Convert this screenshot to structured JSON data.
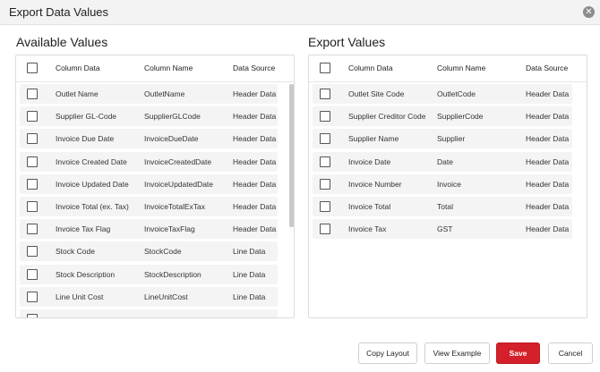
{
  "dialog": {
    "title": "Export Data Values",
    "close_glyph": "✕"
  },
  "available": {
    "title": "Available Values",
    "headers": {
      "col1": "Column Data",
      "col2": "Column Name",
      "col3": "Data Source"
    },
    "rows": [
      {
        "data": "Outlet Name",
        "name": "OutletName",
        "source": "Header Data"
      },
      {
        "data": "Supplier GL-Code",
        "name": "SupplierGLCode",
        "source": "Header Data"
      },
      {
        "data": "Invoice Due Date",
        "name": "InvoiceDueDate",
        "source": "Header Data"
      },
      {
        "data": "Invoice Created Date",
        "name": "InvoiceCreatedDate",
        "source": "Header Data"
      },
      {
        "data": "Invoice Updated Date",
        "name": "InvoiceUpdatedDate",
        "source": "Header Data"
      },
      {
        "data": "Invoice Total (ex. Tax)",
        "name": "InvoiceTotalExTax",
        "source": "Header Data"
      },
      {
        "data": "Invoice Tax Flag",
        "name": "InvoiceTaxFlag",
        "source": "Header Data"
      },
      {
        "data": "Stock Code",
        "name": "StockCode",
        "source": "Line Data"
      },
      {
        "data": "Stock Description",
        "name": "StockDescription",
        "source": "Line Data"
      },
      {
        "data": "Line Unit Cost",
        "name": "LineUnitCost",
        "source": "Line Data"
      },
      {
        "data": "",
        "name": "",
        "source": ""
      }
    ]
  },
  "export": {
    "title": "Export Values",
    "headers": {
      "col1": "Column Data",
      "col2": "Column Name",
      "col3": "Data Source"
    },
    "rows": [
      {
        "data": "Outlet Site Code",
        "name": "OutletCode",
        "source": "Header Data"
      },
      {
        "data": "Supplier Creditor Code",
        "name": "SupplierCode",
        "source": "Header Data"
      },
      {
        "data": "Supplier Name",
        "name": "Supplier",
        "source": "Header Data"
      },
      {
        "data": "Invoice Date",
        "name": "Date",
        "source": "Header Data"
      },
      {
        "data": "Invoice Number",
        "name": "Invoice",
        "source": "Header Data"
      },
      {
        "data": "Invoice Total",
        "name": "Total",
        "source": "Header Data"
      },
      {
        "data": "Invoice Tax",
        "name": "GST",
        "source": "Header Data"
      }
    ]
  },
  "buttons": {
    "copy_layout": "Copy Layout",
    "view_example": "View Example",
    "save": "Save",
    "cancel": "Cancel"
  },
  "colors": {
    "primary": "#d3202a",
    "row_background": "#f4f4f4"
  }
}
